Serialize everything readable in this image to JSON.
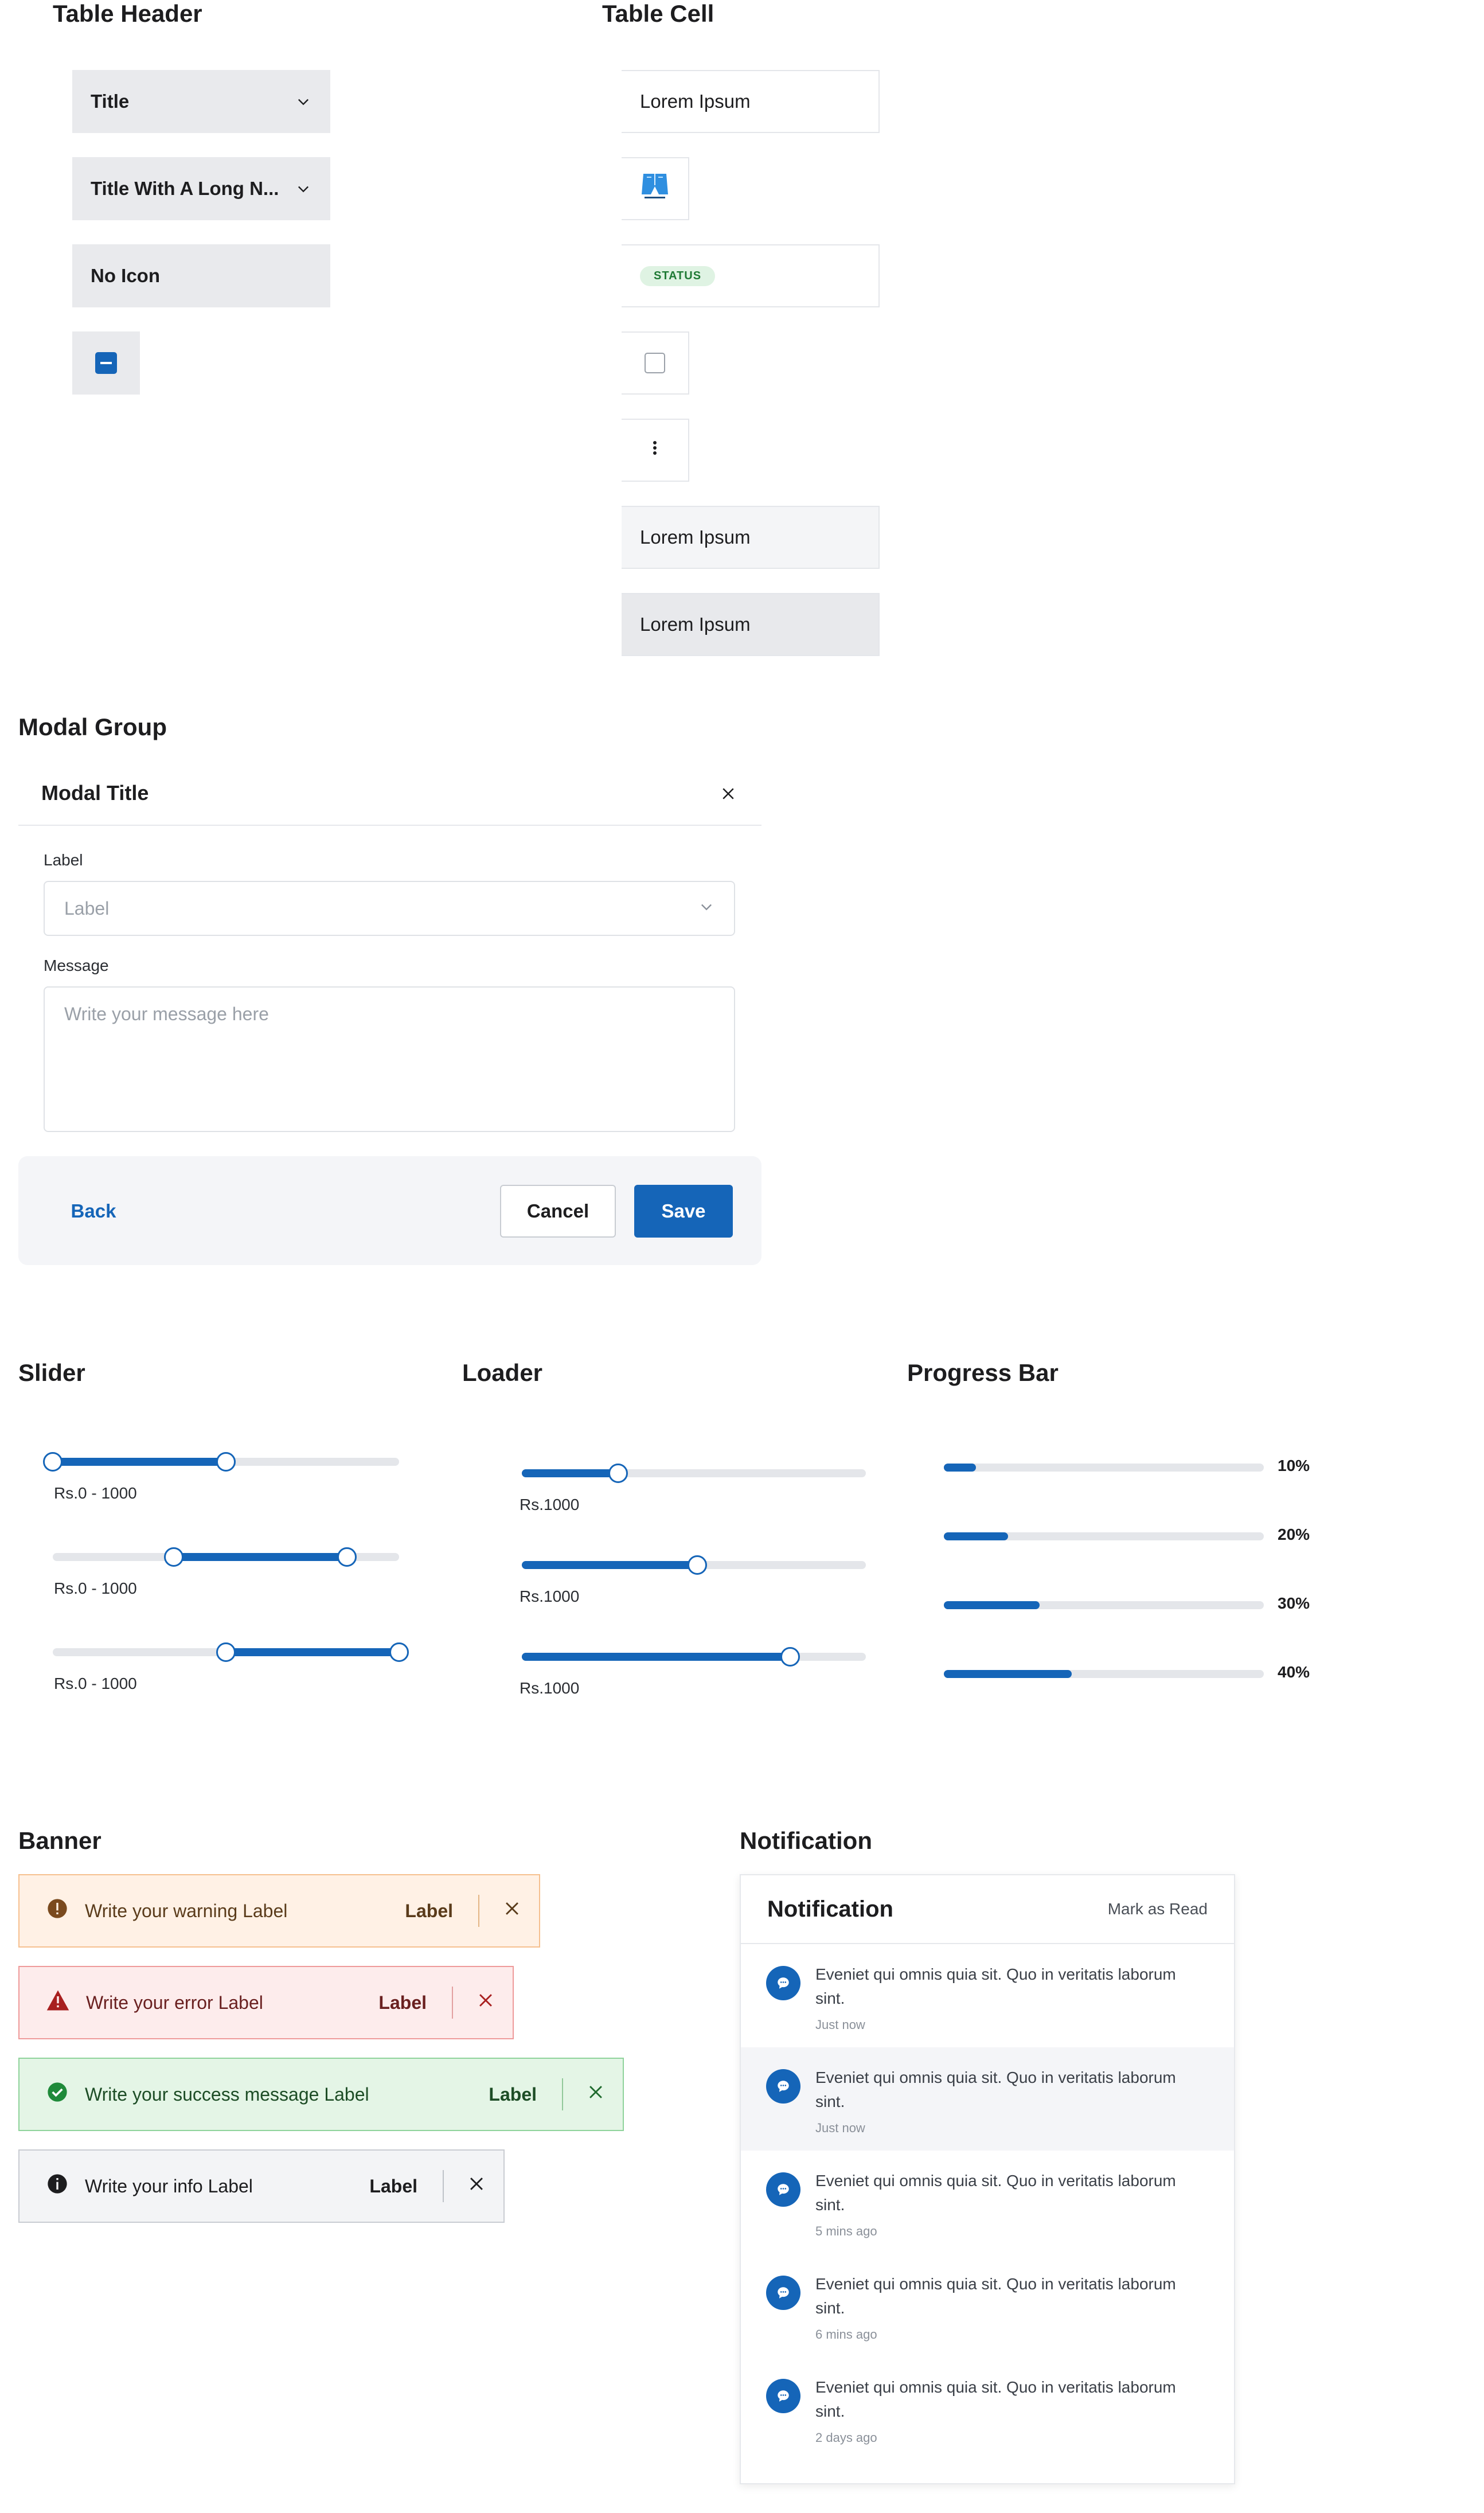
{
  "table_header": {
    "title": "Table Header",
    "headers": [
      "Title",
      "Title With A Long N...",
      "No Icon"
    ]
  },
  "table_cell": {
    "title": "Table Cell",
    "cells": [
      "Lorem Ipsum",
      "Lorem Ipsum",
      "Lorem Ipsum"
    ],
    "status": "STATUS",
    "product_image": "shorts-thumbnail",
    "more_icon": "more-vertical-icon"
  },
  "modal": {
    "section_title": "Modal Group",
    "title": "Modal Title",
    "select_label": "Label",
    "select_placeholder": "Label",
    "message_label": "Message",
    "message_placeholder": "Write your message here",
    "back": "Back",
    "cancel": "Cancel",
    "save": "Save"
  },
  "slider": {
    "title": "Slider",
    "items": [
      {
        "label": "Rs.0 - 1000",
        "low": 0.0,
        "high": 0.5
      },
      {
        "label": "Rs.0 - 1000",
        "low": 0.35,
        "high": 0.85
      },
      {
        "label": "Rs.0 - 1000",
        "low": 0.5,
        "high": 1.0
      }
    ]
  },
  "loader": {
    "title": "Loader",
    "items": [
      {
        "label": "Rs.1000",
        "value": 0.28
      },
      {
        "label": "Rs.1000",
        "value": 0.51
      },
      {
        "label": "Rs.1000",
        "value": 0.78
      }
    ]
  },
  "progress": {
    "title": "Progress Bar",
    "items": [
      {
        "label": "10%",
        "value": 0.1
      },
      {
        "label": "20%",
        "value": 0.2
      },
      {
        "label": "30%",
        "value": 0.3
      },
      {
        "label": "40%",
        "value": 0.4
      }
    ]
  },
  "banner": {
    "title": "Banner",
    "warning": {
      "message": "Write your warning Label",
      "label": "Label"
    },
    "error": {
      "message": "Write your error Label",
      "label": "Label"
    },
    "success": {
      "message": "Write your success message Label",
      "label": "Label"
    },
    "info": {
      "message": "Write your info Label",
      "label": "Label"
    }
  },
  "notification": {
    "section_title": "Notification",
    "title": "Notification",
    "mark_read": "Mark as Read",
    "items": [
      {
        "text": "Eveniet qui omnis quia sit. Quo in veritatis laborum sint.",
        "time": "Just now"
      },
      {
        "text": "Eveniet qui omnis quia sit. Quo in veritatis laborum sint.",
        "time": "Just now"
      },
      {
        "text": "Eveniet qui omnis quia sit. Quo in veritatis laborum sint.",
        "time": "5 mins ago"
      },
      {
        "text": "Eveniet qui omnis quia sit. Quo in veritatis laborum sint.",
        "time": "6 mins ago"
      },
      {
        "text": "Eveniet qui omnis quia sit. Quo in veritatis laborum sint.",
        "time": "2 days ago"
      }
    ]
  },
  "colors": {
    "primary": "#1565b8",
    "warning": "#a35a12",
    "error": "#b42318",
    "success": "#1f8a3a",
    "info": "#1d1d1f"
  }
}
